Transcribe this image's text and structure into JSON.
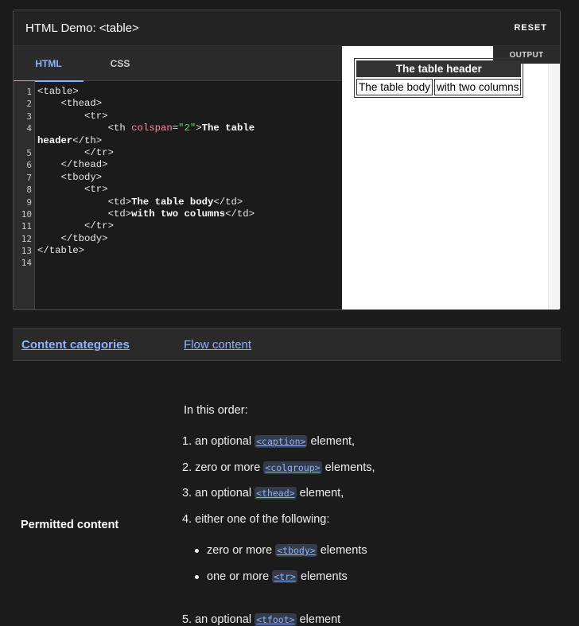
{
  "demo": {
    "title": "HTML Demo: <table>",
    "reset_label": "RESET",
    "tabs": {
      "html": "HTML",
      "css": "CSS"
    },
    "output_label": "OUTPUT",
    "line_numbers": [
      "1",
      "2",
      "3",
      "4",
      "",
      "5",
      "6",
      "7",
      "8",
      "9",
      "10",
      "11",
      "12",
      "13",
      "14"
    ],
    "code": [
      [
        "",
        "<table>"
      ],
      [
        "    ",
        "<thead>"
      ],
      [
        "        ",
        "<tr>"
      ],
      [
        "            ",
        "<th ",
        "colspan",
        "=",
        "\"2\"",
        ">",
        "The table"
      ],
      [
        "header",
        "</th>"
      ],
      [
        "        ",
        "</tr>"
      ],
      [
        "    ",
        "</thead>"
      ],
      [
        "    ",
        "<tbody>"
      ],
      [
        "        ",
        "<tr>"
      ],
      [
        "            ",
        "<td>",
        "The table body",
        "</td>"
      ],
      [
        "            ",
        "<td>",
        "with two columns",
        "</td>"
      ],
      [
        "        ",
        "</tr>"
      ],
      [
        "    ",
        "</tbody>"
      ],
      [
        "",
        "</table>"
      ],
      [
        ""
      ]
    ],
    "preview": {
      "header": "The table header",
      "cells": [
        "The table body",
        "with two columns"
      ]
    }
  },
  "props": {
    "categories_label": "Content categories",
    "categories_value": "Flow content",
    "permitted_label": "Permitted content",
    "intro": "In this order:",
    "items": {
      "i1_pre": "1. an optional",
      "i1_tag": "<caption>",
      "i1_post": "element,",
      "i2_pre": "2. zero or more",
      "i2_tag": "<colgroup>",
      "i2_post": "elements,",
      "i3_pre": "3. an optional",
      "i3_tag": "<thead>",
      "i3_post": "element,",
      "i4": "4. either one of the following:",
      "b1_pre": "zero or more",
      "b1_tag": "<tbody>",
      "b1_post": "elements",
      "b2_pre": "one or more",
      "b2_tag": "<tr>",
      "b2_post": "elements",
      "i5_pre": "5. an optional",
      "i5_tag": "<tfoot>",
      "i5_post": "element"
    }
  }
}
